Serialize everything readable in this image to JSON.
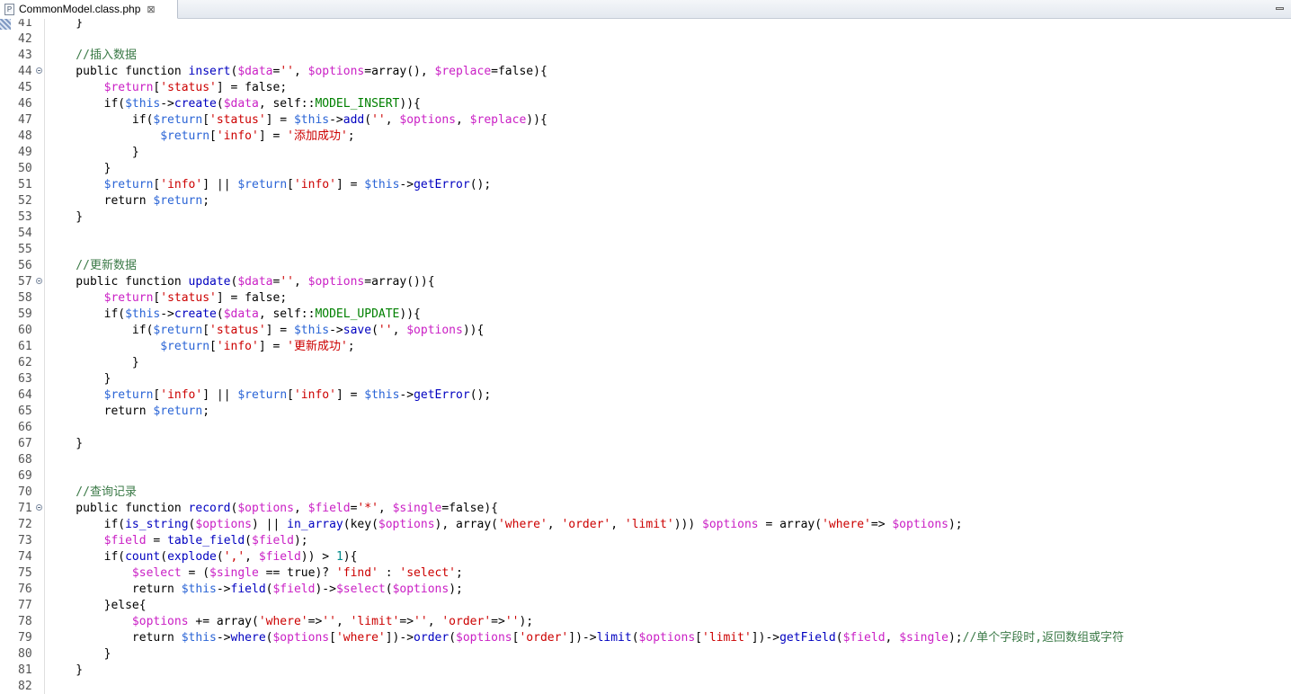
{
  "tab": {
    "filename": "CommonModel.class.php",
    "icon": "P",
    "close_glyph": "⊠"
  },
  "editor": {
    "lines": [
      {
        "num": "41",
        "tokens": [
          [
            "o",
            "    }"
          ]
        ]
      },
      {
        "num": "42",
        "tokens": []
      },
      {
        "num": "43",
        "tokens": [
          [
            "c",
            "    //插入数据"
          ]
        ]
      },
      {
        "num": "44",
        "fold": true,
        "tokens": [
          [
            "k",
            "    public function "
          ],
          [
            "f",
            "insert"
          ],
          [
            "o",
            "("
          ],
          [
            "v",
            "$data"
          ],
          [
            "o",
            "="
          ],
          [
            "s",
            "''"
          ],
          [
            "o",
            ", "
          ],
          [
            "v",
            "$options"
          ],
          [
            "o",
            "=array(), "
          ],
          [
            "v",
            "$replace"
          ],
          [
            "o",
            "=false){"
          ]
        ]
      },
      {
        "num": "45",
        "tokens": [
          [
            "o",
            "        "
          ],
          [
            "v",
            "$return"
          ],
          [
            "o",
            "["
          ],
          [
            "s",
            "'status'"
          ],
          [
            "o",
            "] = false;"
          ]
        ]
      },
      {
        "num": "46",
        "tokens": [
          [
            "o",
            "        if("
          ],
          [
            "t",
            "$this"
          ],
          [
            "o",
            "->"
          ],
          [
            "f",
            "create"
          ],
          [
            "o",
            "("
          ],
          [
            "v",
            "$data"
          ],
          [
            "o",
            ", self::"
          ],
          [
            "m",
            "MODEL_INSERT"
          ],
          [
            "o",
            ")){"
          ]
        ]
      },
      {
        "num": "47",
        "tokens": [
          [
            "o",
            "            if("
          ],
          [
            "t",
            "$return"
          ],
          [
            "o",
            "["
          ],
          [
            "s",
            "'status'"
          ],
          [
            "o",
            "] = "
          ],
          [
            "t",
            "$this"
          ],
          [
            "o",
            "->"
          ],
          [
            "f",
            "add"
          ],
          [
            "o",
            "("
          ],
          [
            "s",
            "''"
          ],
          [
            "o",
            ", "
          ],
          [
            "v",
            "$options"
          ],
          [
            "o",
            ", "
          ],
          [
            "v",
            "$replace"
          ],
          [
            "o",
            ")){"
          ]
        ]
      },
      {
        "num": "48",
        "tokens": [
          [
            "o",
            "                "
          ],
          [
            "t",
            "$return"
          ],
          [
            "o",
            "["
          ],
          [
            "s",
            "'info'"
          ],
          [
            "o",
            "] = "
          ],
          [
            "s",
            "'添加成功'"
          ],
          [
            "o",
            ";"
          ]
        ]
      },
      {
        "num": "49",
        "tokens": [
          [
            "o",
            "            }"
          ]
        ]
      },
      {
        "num": "50",
        "tokens": [
          [
            "o",
            "        }"
          ]
        ]
      },
      {
        "num": "51",
        "tokens": [
          [
            "o",
            "        "
          ],
          [
            "t",
            "$return"
          ],
          [
            "o",
            "["
          ],
          [
            "s",
            "'info'"
          ],
          [
            "o",
            "] || "
          ],
          [
            "t",
            "$return"
          ],
          [
            "o",
            "["
          ],
          [
            "s",
            "'info'"
          ],
          [
            "o",
            "] = "
          ],
          [
            "t",
            "$this"
          ],
          [
            "o",
            "->"
          ],
          [
            "f",
            "getError"
          ],
          [
            "o",
            "();"
          ]
        ]
      },
      {
        "num": "52",
        "tokens": [
          [
            "o",
            "        return "
          ],
          [
            "t",
            "$return"
          ],
          [
            "o",
            ";"
          ]
        ]
      },
      {
        "num": "53",
        "tokens": [
          [
            "o",
            "    }"
          ]
        ]
      },
      {
        "num": "54",
        "tokens": []
      },
      {
        "num": "55",
        "tokens": []
      },
      {
        "num": "56",
        "tokens": [
          [
            "c",
            "    //更新数据"
          ]
        ]
      },
      {
        "num": "57",
        "fold": true,
        "tokens": [
          [
            "k",
            "    public function "
          ],
          [
            "f",
            "update"
          ],
          [
            "o",
            "("
          ],
          [
            "v",
            "$data"
          ],
          [
            "o",
            "="
          ],
          [
            "s",
            "''"
          ],
          [
            "o",
            ", "
          ],
          [
            "v",
            "$options"
          ],
          [
            "o",
            "=array()){"
          ]
        ]
      },
      {
        "num": "58",
        "tokens": [
          [
            "o",
            "        "
          ],
          [
            "v",
            "$return"
          ],
          [
            "o",
            "["
          ],
          [
            "s",
            "'status'"
          ],
          [
            "o",
            "] = false;"
          ]
        ]
      },
      {
        "num": "59",
        "tokens": [
          [
            "o",
            "        if("
          ],
          [
            "t",
            "$this"
          ],
          [
            "o",
            "->"
          ],
          [
            "f",
            "create"
          ],
          [
            "o",
            "("
          ],
          [
            "v",
            "$data"
          ],
          [
            "o",
            ", self::"
          ],
          [
            "m",
            "MODEL_UPDATE"
          ],
          [
            "o",
            ")){"
          ]
        ]
      },
      {
        "num": "60",
        "tokens": [
          [
            "o",
            "            if("
          ],
          [
            "t",
            "$return"
          ],
          [
            "o",
            "["
          ],
          [
            "s",
            "'status'"
          ],
          [
            "o",
            "] = "
          ],
          [
            "t",
            "$this"
          ],
          [
            "o",
            "->"
          ],
          [
            "f",
            "save"
          ],
          [
            "o",
            "("
          ],
          [
            "s",
            "''"
          ],
          [
            "o",
            ", "
          ],
          [
            "v",
            "$options"
          ],
          [
            "o",
            ")){"
          ]
        ]
      },
      {
        "num": "61",
        "tokens": [
          [
            "o",
            "                "
          ],
          [
            "t",
            "$return"
          ],
          [
            "o",
            "["
          ],
          [
            "s",
            "'info'"
          ],
          [
            "o",
            "] = "
          ],
          [
            "s",
            "'更新成功'"
          ],
          [
            "o",
            ";"
          ]
        ]
      },
      {
        "num": "62",
        "tokens": [
          [
            "o",
            "            }"
          ]
        ]
      },
      {
        "num": "63",
        "tokens": [
          [
            "o",
            "        }"
          ]
        ]
      },
      {
        "num": "64",
        "tokens": [
          [
            "o",
            "        "
          ],
          [
            "t",
            "$return"
          ],
          [
            "o",
            "["
          ],
          [
            "s",
            "'info'"
          ],
          [
            "o",
            "] || "
          ],
          [
            "t",
            "$return"
          ],
          [
            "o",
            "["
          ],
          [
            "s",
            "'info'"
          ],
          [
            "o",
            "] = "
          ],
          [
            "t",
            "$this"
          ],
          [
            "o",
            "->"
          ],
          [
            "f",
            "getError"
          ],
          [
            "o",
            "();"
          ]
        ]
      },
      {
        "num": "65",
        "tokens": [
          [
            "o",
            "        return "
          ],
          [
            "t",
            "$return"
          ],
          [
            "o",
            ";"
          ]
        ]
      },
      {
        "num": "66",
        "tokens": []
      },
      {
        "num": "67",
        "tokens": [
          [
            "o",
            "    }"
          ]
        ]
      },
      {
        "num": "68",
        "tokens": []
      },
      {
        "num": "69",
        "tokens": []
      },
      {
        "num": "70",
        "tokens": [
          [
            "c",
            "    //查询记录"
          ]
        ]
      },
      {
        "num": "71",
        "fold": true,
        "tokens": [
          [
            "k",
            "    public function "
          ],
          [
            "f",
            "record"
          ],
          [
            "o",
            "("
          ],
          [
            "v",
            "$options"
          ],
          [
            "o",
            ", "
          ],
          [
            "v",
            "$field"
          ],
          [
            "o",
            "="
          ],
          [
            "s",
            "'*'"
          ],
          [
            "o",
            ", "
          ],
          [
            "v",
            "$single"
          ],
          [
            "o",
            "=false){"
          ]
        ]
      },
      {
        "num": "72",
        "tokens": [
          [
            "o",
            "        if("
          ],
          [
            "f",
            "is_string"
          ],
          [
            "o",
            "("
          ],
          [
            "v",
            "$options"
          ],
          [
            "o",
            ") || "
          ],
          [
            "f",
            "in_array"
          ],
          [
            "o",
            "(key("
          ],
          [
            "v",
            "$options"
          ],
          [
            "o",
            "), array("
          ],
          [
            "s",
            "'where'"
          ],
          [
            "o",
            ", "
          ],
          [
            "s",
            "'order'"
          ],
          [
            "o",
            ", "
          ],
          [
            "s",
            "'limit'"
          ],
          [
            "o",
            "))) "
          ],
          [
            "v",
            "$options"
          ],
          [
            "o",
            " = array("
          ],
          [
            "s",
            "'where'"
          ],
          [
            "o",
            "=> "
          ],
          [
            "v",
            "$options"
          ],
          [
            "o",
            ");"
          ]
        ]
      },
      {
        "num": "73",
        "tokens": [
          [
            "o",
            "        "
          ],
          [
            "v",
            "$field"
          ],
          [
            "o",
            " = "
          ],
          [
            "f",
            "table_field"
          ],
          [
            "o",
            "("
          ],
          [
            "v",
            "$field"
          ],
          [
            "o",
            ");"
          ]
        ]
      },
      {
        "num": "74",
        "tokens": [
          [
            "o",
            "        if("
          ],
          [
            "f",
            "count"
          ],
          [
            "o",
            "("
          ],
          [
            "f",
            "explode"
          ],
          [
            "o",
            "("
          ],
          [
            "s",
            "','"
          ],
          [
            "o",
            ", "
          ],
          [
            "v",
            "$field"
          ],
          [
            "o",
            ")) > "
          ],
          [
            "n",
            "1"
          ],
          [
            "o",
            "){"
          ]
        ]
      },
      {
        "num": "75",
        "tokens": [
          [
            "o",
            "            "
          ],
          [
            "v",
            "$select"
          ],
          [
            "o",
            " = ("
          ],
          [
            "v",
            "$single"
          ],
          [
            "o",
            " == true)? "
          ],
          [
            "s",
            "'find'"
          ],
          [
            "o",
            " : "
          ],
          [
            "s",
            "'select'"
          ],
          [
            "o",
            ";"
          ]
        ]
      },
      {
        "num": "76",
        "tokens": [
          [
            "o",
            "            return "
          ],
          [
            "t",
            "$this"
          ],
          [
            "o",
            "->"
          ],
          [
            "f",
            "field"
          ],
          [
            "o",
            "("
          ],
          [
            "v",
            "$field"
          ],
          [
            "o",
            ")->"
          ],
          [
            "v",
            "$select"
          ],
          [
            "o",
            "("
          ],
          [
            "v",
            "$options"
          ],
          [
            "o",
            ");"
          ]
        ]
      },
      {
        "num": "77",
        "tokens": [
          [
            "o",
            "        }else{"
          ]
        ]
      },
      {
        "num": "78",
        "tokens": [
          [
            "o",
            "            "
          ],
          [
            "v",
            "$options"
          ],
          [
            "o",
            " += array("
          ],
          [
            "s",
            "'where'"
          ],
          [
            "o",
            "=>"
          ],
          [
            "s",
            "''"
          ],
          [
            "o",
            ", "
          ],
          [
            "s",
            "'limit'"
          ],
          [
            "o",
            "=>"
          ],
          [
            "s",
            "''"
          ],
          [
            "o",
            ", "
          ],
          [
            "s",
            "'order'"
          ],
          [
            "o",
            "=>"
          ],
          [
            "s",
            "''"
          ],
          [
            "o",
            ");"
          ]
        ]
      },
      {
        "num": "79",
        "tokens": [
          [
            "o",
            "            return "
          ],
          [
            "t",
            "$this"
          ],
          [
            "o",
            "->"
          ],
          [
            "f",
            "where"
          ],
          [
            "o",
            "("
          ],
          [
            "v",
            "$options"
          ],
          [
            "o",
            "["
          ],
          [
            "s",
            "'where'"
          ],
          [
            "o",
            "])->"
          ],
          [
            "f",
            "order"
          ],
          [
            "o",
            "("
          ],
          [
            "v",
            "$options"
          ],
          [
            "o",
            "["
          ],
          [
            "s",
            "'order'"
          ],
          [
            "o",
            "])->"
          ],
          [
            "f",
            "limit"
          ],
          [
            "o",
            "("
          ],
          [
            "v",
            "$options"
          ],
          [
            "o",
            "["
          ],
          [
            "s",
            "'limit'"
          ],
          [
            "o",
            "])->"
          ],
          [
            "f",
            "getField"
          ],
          [
            "o",
            "("
          ],
          [
            "v",
            "$field"
          ],
          [
            "o",
            ", "
          ],
          [
            "v",
            "$single"
          ],
          [
            "o",
            ");"
          ],
          [
            "c",
            "//单个字段时,返回数组或字符"
          ]
        ]
      },
      {
        "num": "80",
        "tokens": [
          [
            "o",
            "        }"
          ]
        ]
      },
      {
        "num": "81",
        "tokens": [
          [
            "o",
            "    }"
          ]
        ]
      },
      {
        "num": "82",
        "tokens": []
      }
    ]
  }
}
